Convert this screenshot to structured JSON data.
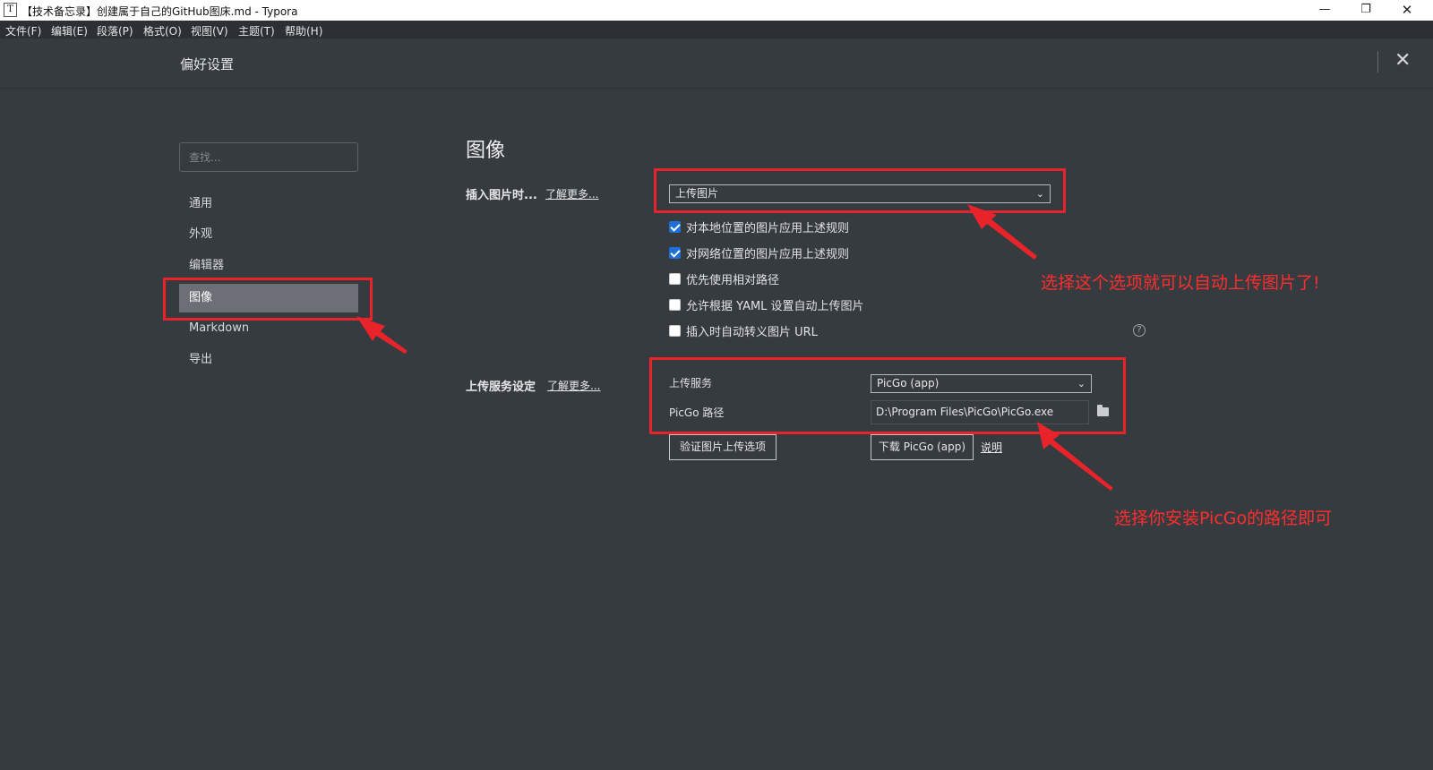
{
  "window": {
    "app_icon": "T",
    "title": "【技术备忘录】创建属于自己的GitHub图床.md - Typora",
    "minimize_glyph": "—",
    "maximize_glyph": "❐",
    "close_glyph": "✕"
  },
  "menu": [
    "文件(F)",
    "编辑(E)",
    "段落(P)",
    "格式(O)",
    "视图(V)",
    "主题(T)",
    "帮助(H)"
  ],
  "header": {
    "title": "偏好设置",
    "close_glyph": "✕"
  },
  "sidebar": {
    "search_placeholder": "查找...",
    "items": [
      {
        "label": "通用",
        "active": false
      },
      {
        "label": "外观",
        "active": false
      },
      {
        "label": "编辑器",
        "active": false
      },
      {
        "label": "图像",
        "active": true
      },
      {
        "label": "Markdown",
        "active": false
      },
      {
        "label": "导出",
        "active": false
      }
    ]
  },
  "main": {
    "section_title": "图像",
    "insert": {
      "label": "插入图片时...",
      "learn_more": "了解更多...",
      "select_value": "上传图片",
      "chevron": "⌄"
    },
    "checkboxes": [
      {
        "label": "对本地位置的图片应用上述规则",
        "checked": true
      },
      {
        "label": "对网络位置的图片应用上述规则",
        "checked": true
      },
      {
        "label": "优先使用相对路径",
        "checked": false
      },
      {
        "label": "允许根据 YAML 设置自动上传图片",
        "checked": false
      },
      {
        "label": "插入时自动转义图片 URL",
        "checked": false
      }
    ],
    "help_glyph": "?",
    "upload": {
      "label": "上传服务设定",
      "learn_more": "了解更多...",
      "service_label": "上传服务",
      "service_value": "PicGo (app)",
      "path_label": "PicGo 路径",
      "path_value": "D:\\Program Files\\PicGo\\PicGo.exe",
      "verify_button": "验证图片上传选项",
      "download_button": "下载 PicGo (app)",
      "doc_link": "说明"
    }
  },
  "annotations": {
    "upload_note": "选择这个选项就可以自动上传图片了!",
    "path_note": "选择你安装PicGo的路径即可",
    "color": "#ff2d2d"
  }
}
